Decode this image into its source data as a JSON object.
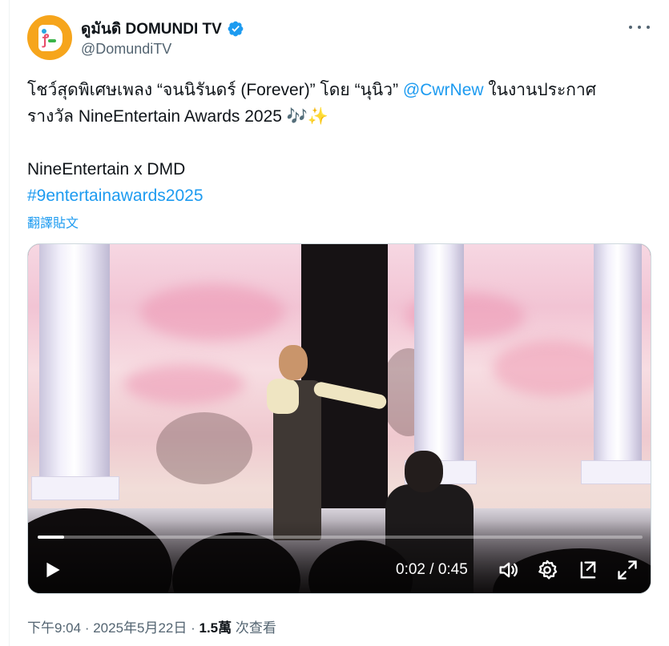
{
  "author": {
    "display_name": "ดูมันดิ DOMUNDI TV",
    "handle": "@DomundiTV",
    "verified": true
  },
  "tweet": {
    "line1_before": "โชว์สุดพิเศษเพลง “จนนิรันดร์ (Forever)” โดย “นุนิว” ",
    "mention": "@CwrNew",
    "line1_after": " ในงานประกาศ",
    "line2": "รางวัล NineEntertain Awards 2025 🎶✨",
    "line3": "NineEntertain x DMD",
    "hashtag": "#9entertainawards2025",
    "translate_label": "翻譯貼文"
  },
  "video": {
    "current_time": "0:02",
    "separator": " / ",
    "duration": "0:45",
    "progress": 0.044
  },
  "footer": {
    "time": "下午9:04",
    "dot1": " · ",
    "date": "2025年5月22日",
    "dot2": " · ",
    "views": "1.5萬",
    "views_label": " 次查看"
  },
  "colors": {
    "accent": "#1d9bf0",
    "secondary_text": "#536471",
    "avatar_bg": "#f6a51c"
  },
  "icons": [
    "verified-badge-icon",
    "more-icon",
    "play-icon",
    "volume-icon",
    "settings-icon",
    "pop-out-icon",
    "fullscreen-icon"
  ]
}
